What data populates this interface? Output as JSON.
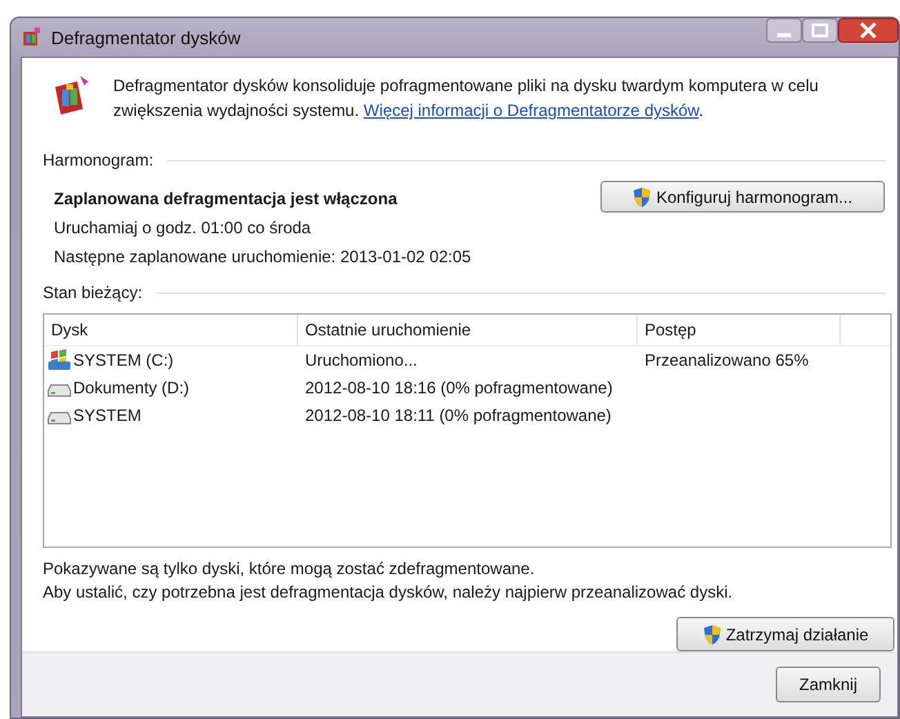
{
  "window": {
    "title": "Defragmentator dysków"
  },
  "intro": {
    "text": "Defragmentator dysków konsoliduje pofragmentowane pliki na dysku twardym komputera w celu zwiększenia wydajności systemu.",
    "link": "Więcej informacji o Defragmentatorze dysków",
    "end": "."
  },
  "schedule": {
    "label": "Harmonogram:",
    "status": "Zaplanowana defragmentacja jest włączona",
    "run_time": "Uruchamiaj o godz. 01:00 co środa",
    "next_run": "Następne zaplanowane uruchomienie: 2013-01-02 02:05",
    "button": "Konfiguruj harmonogram..."
  },
  "current": {
    "label": "Stan bieżący:",
    "columns": [
      "Dysk",
      "Ostatnie uruchomienie",
      "Postęp"
    ],
    "rows": [
      {
        "kind": "system",
        "disk": "SYSTEM (C:)",
        "last_run": "Uruchomiono...",
        "progress": "Przeanalizowano 65%"
      },
      {
        "kind": "drive",
        "disk": "Dokumenty (D:)",
        "last_run": "2012-08-10 18:16 (0% pofragmentowane)"
      },
      {
        "kind": "drive",
        "disk": "SYSTEM",
        "last_run": "2012-08-10 18:11 (0% pofragmentowane)"
      }
    ]
  },
  "notes": [
    "Pokazywane są tylko dyski, które mogą zostać zdefragmentowane.",
    "Aby ustalić, czy potrzebna jest defragmentacja dysków, należy najpierw przeanalizować dyski."
  ],
  "buttons": {
    "stop": "Zatrzymaj działanie",
    "close": "Zamknij"
  }
}
